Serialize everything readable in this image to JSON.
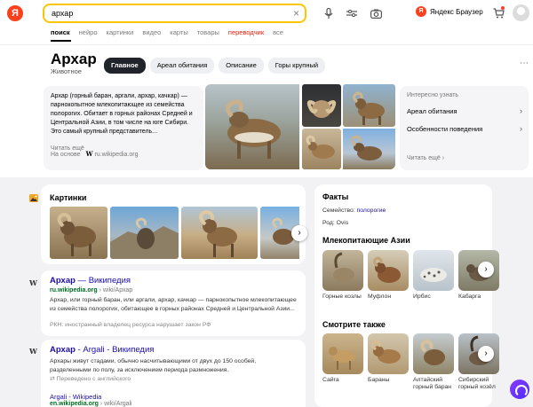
{
  "header": {
    "logo": "Я",
    "search_value": "архар",
    "browser_label": "Яндекс Браузер",
    "browser_logo": "Я",
    "tabs": [
      "поиск",
      "нейро",
      "картинки",
      "видео",
      "карты",
      "товары",
      "переводчик",
      "все"
    ]
  },
  "entity": {
    "title": "Архар",
    "subtitle": "Животное",
    "chips": [
      "Главное",
      "Ареал обитания",
      "Описание",
      "Горы крупный"
    ],
    "description": "Архар (горный баран, аргали, архар, качкар) — парнокопытное млекопитающее из семейства полорогих. Обитает в горных районах Средней и Центральной Азии, в том числе на юге Сибири. Это самый крупный представитель...",
    "read_more": "Читать ещё",
    "source_prefix": "На основе",
    "source_icon": "W",
    "source_name": "ru.wikipedia.org",
    "facts_heading": "Интересно узнать",
    "facts": [
      "Ареал обитания",
      "Особенности поведения"
    ],
    "facts_more": "Читать ещё",
    "more_icon": "more-dots-icon"
  },
  "images_block": {
    "title": "Картинки"
  },
  "results": [
    {
      "icon": "W",
      "title_bold": "Архар",
      "title_rest": " — Википедия",
      "url_domain": "ru.wikipedia.org",
      "url_path": " › wiki/Архар",
      "snippet": "Архар, или горный баран, или аргали, архар, качкар — парнокопытное млекопитающее из семейства полорогих, обитающее в горных районах Средней и Центральной Азии...",
      "note": "РКН: иностранный владелец ресурса нарушает закон РФ"
    },
    {
      "icon": "W",
      "title_bold": "Архар",
      "title_rest": " - Argali - Википедия",
      "snippet": "Архары живут стадами, обычно насчитывающими от двух до 150 особей, разделенными по полу, за исключением периода размножения.",
      "translated": "Переведено с английского",
      "sub_title": "Argali - Wikipedia",
      "sub_url_domain": "en.wikipedia.org",
      "sub_url_path": " › wiki/Argali"
    }
  ],
  "facts_panel": {
    "title": "Факты",
    "family_label": "Семейство:",
    "family_value": "полорогие",
    "genus_label": "Род:",
    "genus_value": "Ovis"
  },
  "mammals": {
    "title": "Млекопитающие Азии",
    "items": [
      "Горные козлы",
      "Муфлон",
      "Ирбис",
      "Кабарга"
    ]
  },
  "see_also": {
    "title": "Смотрите также",
    "items": [
      "Сайга",
      "Бараны",
      "Алтайский горный баран",
      "Сибирский горный козёл"
    ]
  },
  "colors": {
    "accent": "#fdc400",
    "brand": "#fc3f1d",
    "link": "#1a0dab",
    "url": "#006d21"
  }
}
